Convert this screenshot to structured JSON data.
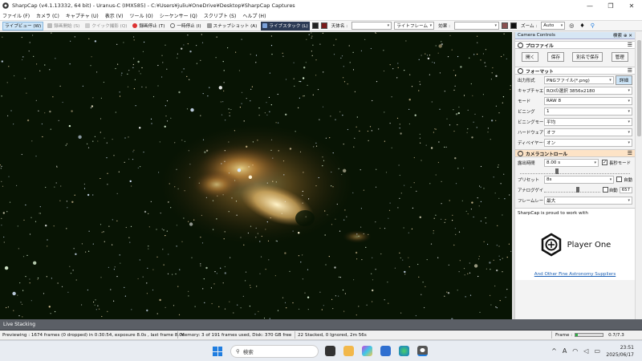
{
  "window": {
    "title": "SharpCap (v4.1.13332, 64 bit) - Uranus-C (IMX585) - C:¥Users¥juliu¥OneDrive¥Desktop¥SharpCap Captures",
    "controls": [
      "—",
      "❐",
      "✕"
    ]
  },
  "menu": [
    "ファイル (F)",
    "カメラ (C)",
    "キャプチャ (U)",
    "表示 (V)",
    "ツール (O)",
    "シーケンサー (Q)",
    "スクリプト (S)",
    "ヘルプ (H)"
  ],
  "toolbar": {
    "live_view": "ライブビュー (W)",
    "start_capture": "録画開始 (S)",
    "quick_capture": "クイック撮影 (Q)",
    "stop_capture": "録画停止 (T)",
    "pause": "一時停止 (I)",
    "snapshot": "スナップショット (A)",
    "live_stack": "ライブスタック (L)",
    "target_label": "天体名 :",
    "target_value": "",
    "frame_type": "ライトフレーム",
    "effect_label": "効果 :",
    "effect_value": "",
    "zoom_label": "ズーム :",
    "zoom_value": "Auto"
  },
  "panel": {
    "header": "Camera Controls",
    "header_icons": "検索 ⊕ ✕",
    "profile": {
      "title": "プロファイル",
      "buttons": [
        "開く",
        "保存",
        "別名で保存",
        "管理"
      ]
    },
    "format": {
      "title": "フォーマット",
      "output_label": "出力形式",
      "output_value": "PNGファイル(*.png)",
      "output_button": "詳細",
      "roi_label": "キャプチャエリア",
      "roi_value": "ROIの選択 3856x2180",
      "mode_label": "モード",
      "mode_value": "RAW 8",
      "binning_label": "ビニング",
      "binning_value": "1",
      "binmode_label": "ビニングモード",
      "binmode_value": "平均",
      "hwbin_label": "ハードウェアビニング",
      "hwbin_value": "オフ",
      "debayer_label": "ディベイヤーモード",
      "debayer_value": "オン"
    },
    "camera": {
      "title": "カメラコントロール",
      "exposure_label": "露出時間",
      "exposure_value": "8.00 s",
      "long_exposure_label": "長秒モード",
      "long_exposure_checked": true,
      "preset_label": "プリセット",
      "preset_value": "8s",
      "auto_label": "自動",
      "gain_label": "アナログゲイン",
      "gain_auto": "自動",
      "gain_value": "657",
      "framerate_label": "フレームレート",
      "framerate_value": "最大"
    },
    "sponsor_text": "SharpCap is proud to work with",
    "sponsor_name": "Player One",
    "sponsor_link": "And Other Fine Astronomy Suppliers"
  },
  "live_stack_label": "Live Stacking",
  "status": {
    "preview": "Previewing : 1674 frames (0 dropped) in 0:30:54, exposure 8.0s , last frame 8.0s",
    "memory": "Memory: 3 of 191 frames used, Disk: 370 GB free",
    "stacked": "22 Stacked, 0 Ignored, 2m 56s",
    "frame_label": "Frame :",
    "frame_value": "0.7/7.3",
    "frame_progress": 0.1
  },
  "taskbar": {
    "search_placeholder": "検索",
    "tray_ime": "A",
    "time": "23:51",
    "date": "2025/06/17"
  },
  "colors": {
    "sky": "#081404",
    "nebula_core": "#ead58c",
    "nebula_glow": "#b06a2a",
    "section_orange": "#fde3c6",
    "accent": "#1f7de0"
  }
}
